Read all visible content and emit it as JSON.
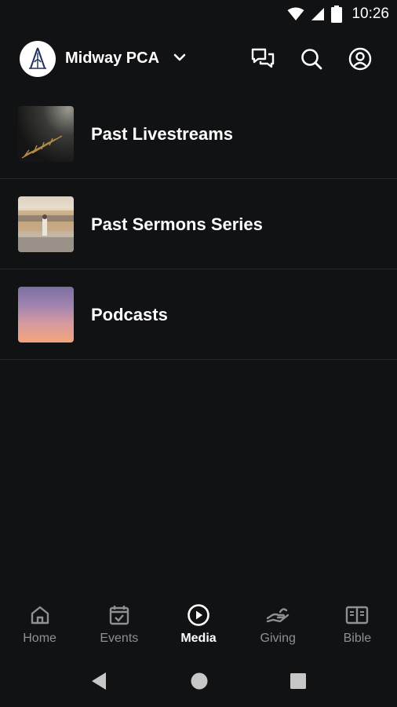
{
  "status": {
    "time": "10:26"
  },
  "header": {
    "org_name": "Midway PCA",
    "icons": [
      "chat-icon",
      "search-icon",
      "account-icon"
    ]
  },
  "media": {
    "items": [
      {
        "label": "Past Livestreams",
        "thumb": "dark-grass-photo"
      },
      {
        "label": "Past Sermons Series",
        "thumb": "train-platform-photo"
      },
      {
        "label": "Podcasts",
        "thumb": "sunset-sky-photo"
      }
    ]
  },
  "nav": {
    "items": [
      {
        "label": "Home",
        "icon": "home-icon"
      },
      {
        "label": "Events",
        "icon": "calendar-icon"
      },
      {
        "label": "Media",
        "icon": "play-icon",
        "active": true
      },
      {
        "label": "Giving",
        "icon": "giving-hand-icon"
      },
      {
        "label": "Bible",
        "icon": "bible-icon"
      }
    ]
  },
  "colors": {
    "background": "#111214",
    "text": "#ffffff",
    "muted": "#8e9094",
    "divider": "#26282b"
  }
}
